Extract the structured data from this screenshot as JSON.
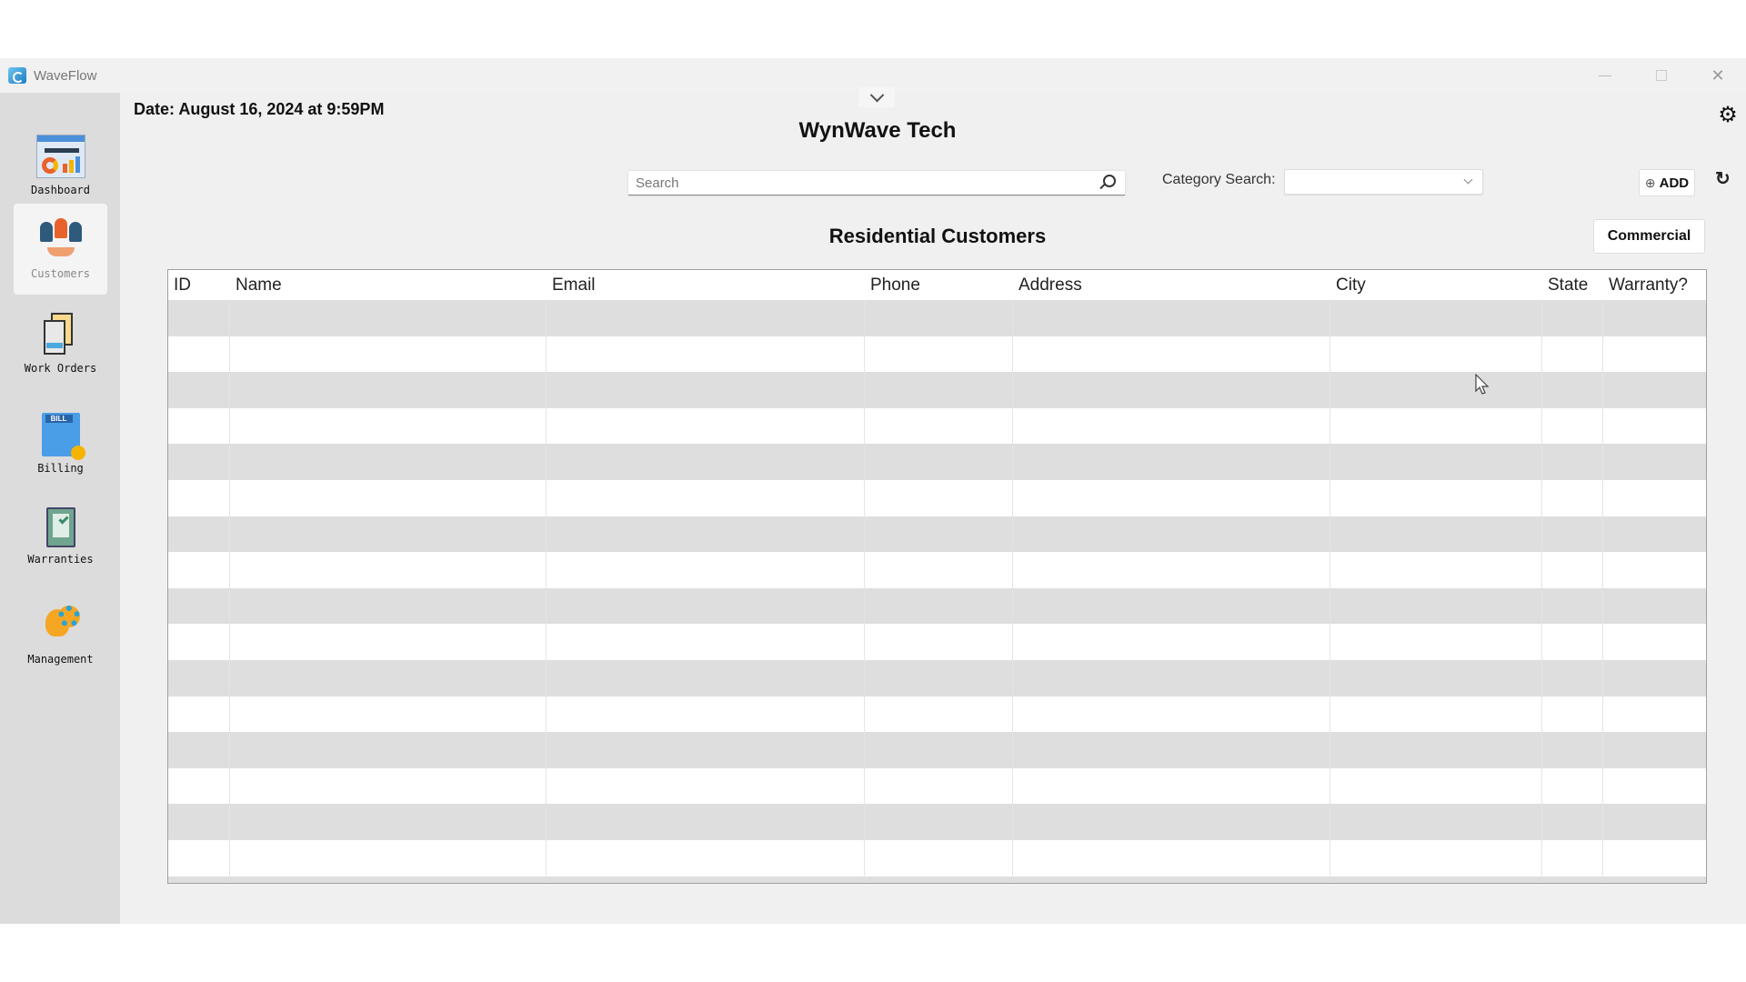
{
  "window": {
    "app_title": "WaveFlow",
    "app_icon": "waveflow-logo-icon",
    "controls": [
      "minimize",
      "maximize",
      "close"
    ]
  },
  "sidebar": {
    "items": [
      {
        "label": "Dashboard",
        "icon": "dashboard-icon",
        "active": false
      },
      {
        "label": "Customers",
        "icon": "customers-icon",
        "active": true
      },
      {
        "label": "Work Orders",
        "icon": "work-orders-icon",
        "active": false
      },
      {
        "label": "Billing",
        "icon": "billing-icon",
        "active": false
      },
      {
        "label": "Warranties",
        "icon": "warranties-icon",
        "active": false
      },
      {
        "label": "Management",
        "icon": "management-icon",
        "active": false
      }
    ]
  },
  "header": {
    "date": "Date: August 16, 2024 at 9:59PM",
    "company": "WynWave Tech",
    "settings_icon": "gear-icon",
    "collapse_icon": "chevron-down-icon"
  },
  "toolbar": {
    "search_placeholder": "Search",
    "search_value": "",
    "category_label": "Category Search:",
    "category_value": "",
    "add_label": "ADD",
    "add_icon": "⊕",
    "refresh_icon": "↻",
    "settings_glyph": "⚙"
  },
  "main": {
    "section_title": "Residential Customers",
    "toggle_button": "Commercial",
    "table": {
      "columns": [
        "ID",
        "Name",
        "Email",
        "Phone",
        "Address",
        "City",
        "State",
        "Warranty?"
      ],
      "rows": []
    }
  },
  "colors": {
    "sidebar_bg": "#dcdcdc",
    "window_bg": "#f0f0f0",
    "row_stripe": "#dedede"
  }
}
